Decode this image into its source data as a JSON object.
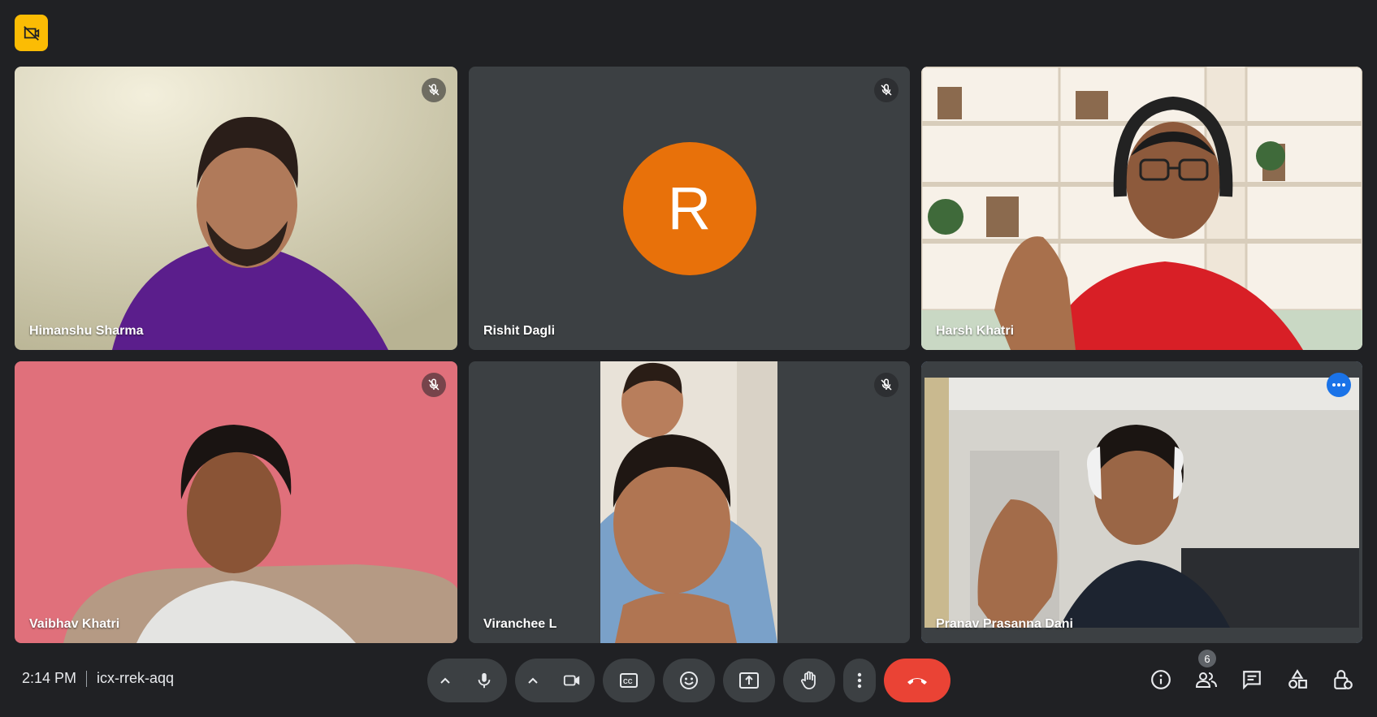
{
  "meeting": {
    "time": "2:14 PM",
    "code": "icx-rrek-aqq",
    "participant_count": "6"
  },
  "participants": [
    {
      "name": "Himanshu Sharma",
      "muted": true
    },
    {
      "name": "Rishit Dagli",
      "muted": true,
      "avatar_letter": "R",
      "avatar_color": "#e8710a"
    },
    {
      "name": "Harsh Khatri",
      "muted": false
    },
    {
      "name": "Vaibhav Khatri",
      "muted": true
    },
    {
      "name": "Viranchee L",
      "muted": true
    },
    {
      "name": "Pranav Prasanna Dani",
      "muted": false,
      "active_speaker": true
    }
  ],
  "colors": {
    "background": "#202124",
    "tile": "#3c4043",
    "end_call": "#ea4335",
    "active_outline": "#8ab4f8",
    "recording": "#fbbc04"
  },
  "icons": {
    "recording": "no-recording-icon",
    "mic": "mic-icon",
    "camera": "camera-icon",
    "captions": "captions-icon",
    "emoji": "emoji-icon",
    "present": "present-screen-icon",
    "hand": "raise-hand-icon",
    "more": "more-options-icon",
    "end": "end-call-icon",
    "info": "info-icon",
    "people": "people-icon",
    "chat": "chat-icon",
    "activities": "activities-icon",
    "host": "host-controls-icon"
  }
}
